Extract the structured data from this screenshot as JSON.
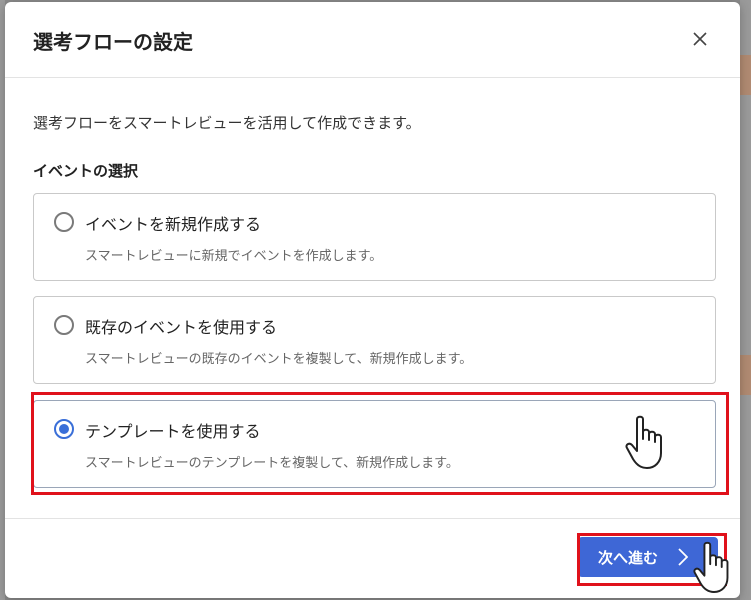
{
  "dialog": {
    "title": "選考フローの設定",
    "description": "選考フローをスマートレビューを活用して作成できます。",
    "section_label": "イベントの選択",
    "close_icon": "close-icon"
  },
  "options": [
    {
      "title": "イベントを新規作成する",
      "subtitle": "スマートレビューに新規でイベントを作成します。",
      "selected": false
    },
    {
      "title": "既存のイベントを使用する",
      "subtitle": "スマートレビューの既存のイベントを複製して、新規作成します。",
      "selected": false
    },
    {
      "title": "テンプレートを使用する",
      "subtitle": "スマートレビューのテンプレートを複製して、新規作成します。",
      "selected": true
    }
  ],
  "footer": {
    "next_label": "次へ進む",
    "next_icon": "chevron-right-icon"
  },
  "colors": {
    "accent": "#3e67d6",
    "radio_checked": "#3a6fd8",
    "highlight": "#e0111b",
    "overlay": "#8b8b8b"
  }
}
